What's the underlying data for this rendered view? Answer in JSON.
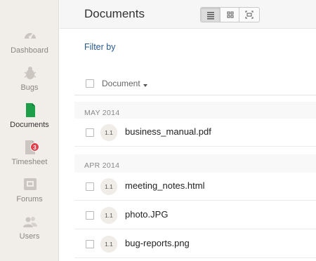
{
  "sidebar": {
    "items": [
      {
        "label": "Dashboard",
        "icon": "dashboard-gauge-icon",
        "active": false
      },
      {
        "label": "Bugs",
        "icon": "bug-icon",
        "active": false
      },
      {
        "label": "Documents",
        "icon": "document-icon",
        "active": true
      },
      {
        "label": "Timesheet",
        "icon": "timesheet-icon",
        "active": false,
        "badge": "3"
      },
      {
        "label": "Forums",
        "icon": "forum-icon",
        "active": false
      },
      {
        "label": "Users",
        "icon": "users-icon",
        "active": false
      }
    ]
  },
  "header": {
    "title": "Documents",
    "view_modes": [
      "list-view-icon",
      "grid-view-icon",
      "fullscreen-view-icon"
    ],
    "active_view": "list-view-icon"
  },
  "filter": {
    "label": "Filter by"
  },
  "table": {
    "column_label": "Document"
  },
  "sections": [
    {
      "label": "MAY 2014",
      "rows": [
        {
          "version": "1.1",
          "filename": "business_manual.pdf"
        }
      ]
    },
    {
      "label": "APR 2014",
      "rows": [
        {
          "version": "1.1",
          "filename": "meeting_notes.html"
        },
        {
          "version": "1.1",
          "filename": "photo.JPG"
        },
        {
          "version": "1.1",
          "filename": "bug-reports.png"
        }
      ]
    }
  ],
  "colors": {
    "sidebar_bg": "#f1eeea",
    "active_icon": "#1f9e4a",
    "badge": "#e0424c",
    "link": "#2a5a8c"
  }
}
